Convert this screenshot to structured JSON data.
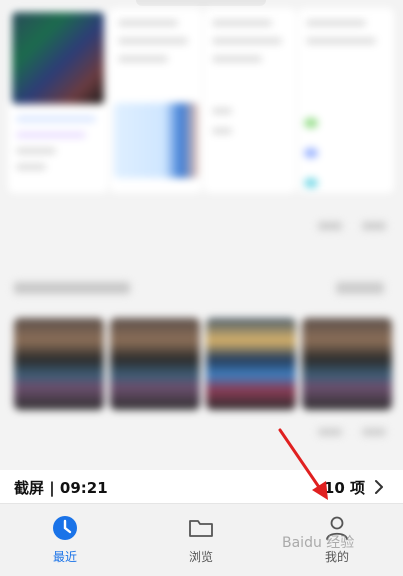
{
  "info": {
    "left_text": "截屏 | 09:21",
    "right_text": "10 项"
  },
  "tabs": [
    {
      "label": "最近",
      "icon": "clock-icon",
      "active": true
    },
    {
      "label": "浏览",
      "icon": "folder-icon",
      "active": false
    },
    {
      "label": "我的",
      "icon": "person-icon",
      "active": false
    }
  ],
  "colors": {
    "accent": "#1a73e8",
    "arrow": "#e02020"
  },
  "watermark": "Baidu 经验"
}
